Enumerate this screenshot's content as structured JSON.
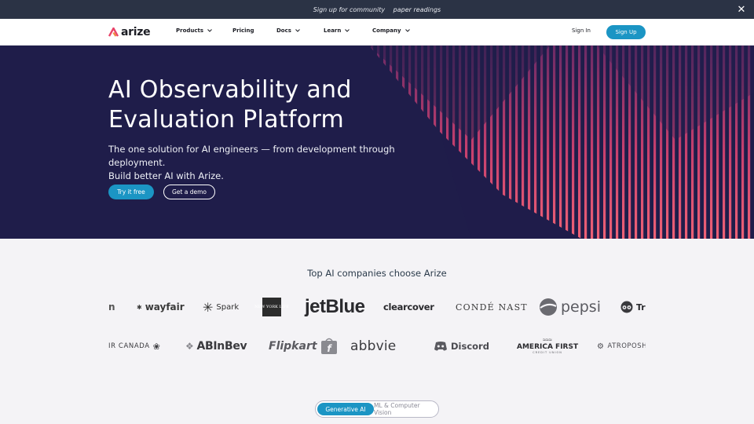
{
  "announcement": {
    "text": "Sign up for community  paper readings",
    "close_label": "✕"
  },
  "brand": {
    "name": "arize"
  },
  "nav": {
    "items": [
      {
        "label": "Products"
      },
      {
        "label": "Pricing"
      },
      {
        "label": "Docs"
      },
      {
        "label": "Learn"
      },
      {
        "label": "Company"
      }
    ],
    "sign_in": "Sign In",
    "sign_up": "Sign Up"
  },
  "hero": {
    "title_line1": "AI Observability and",
    "title_line2": "Evaluation Platform",
    "subtitle_line1": "The one solution for AI engineers — from development through deployment.",
    "subtitle_line2": "Build better AI with Arize.",
    "primary_cta": "Try it free",
    "secondary_cta": "Get a demo"
  },
  "logos": {
    "heading": "Top AI companies choose Arize",
    "row1": [
      "n",
      "wayfair",
      "Spark",
      "NEW YORK LIFE",
      "jetBlue",
      "clearcover",
      "CONDÉ NAST",
      "pepsi",
      "Tri"
    ],
    "row2": [
      "IR CANADA",
      "ABInBev",
      "Flipkart",
      "abbvie",
      "Discord",
      "AMERICA FIRST",
      "CREDIT UNION",
      "ATROPOSHE"
    ]
  },
  "toggle": {
    "active": "Generative AI",
    "inactive": "ML & Computer Vision"
  },
  "colors": {
    "accent": "#1b95c4",
    "hero_bg": "#1f1d4a",
    "stripe_top": "#7a2a6a",
    "stripe_bottom": "#ea5a74"
  }
}
